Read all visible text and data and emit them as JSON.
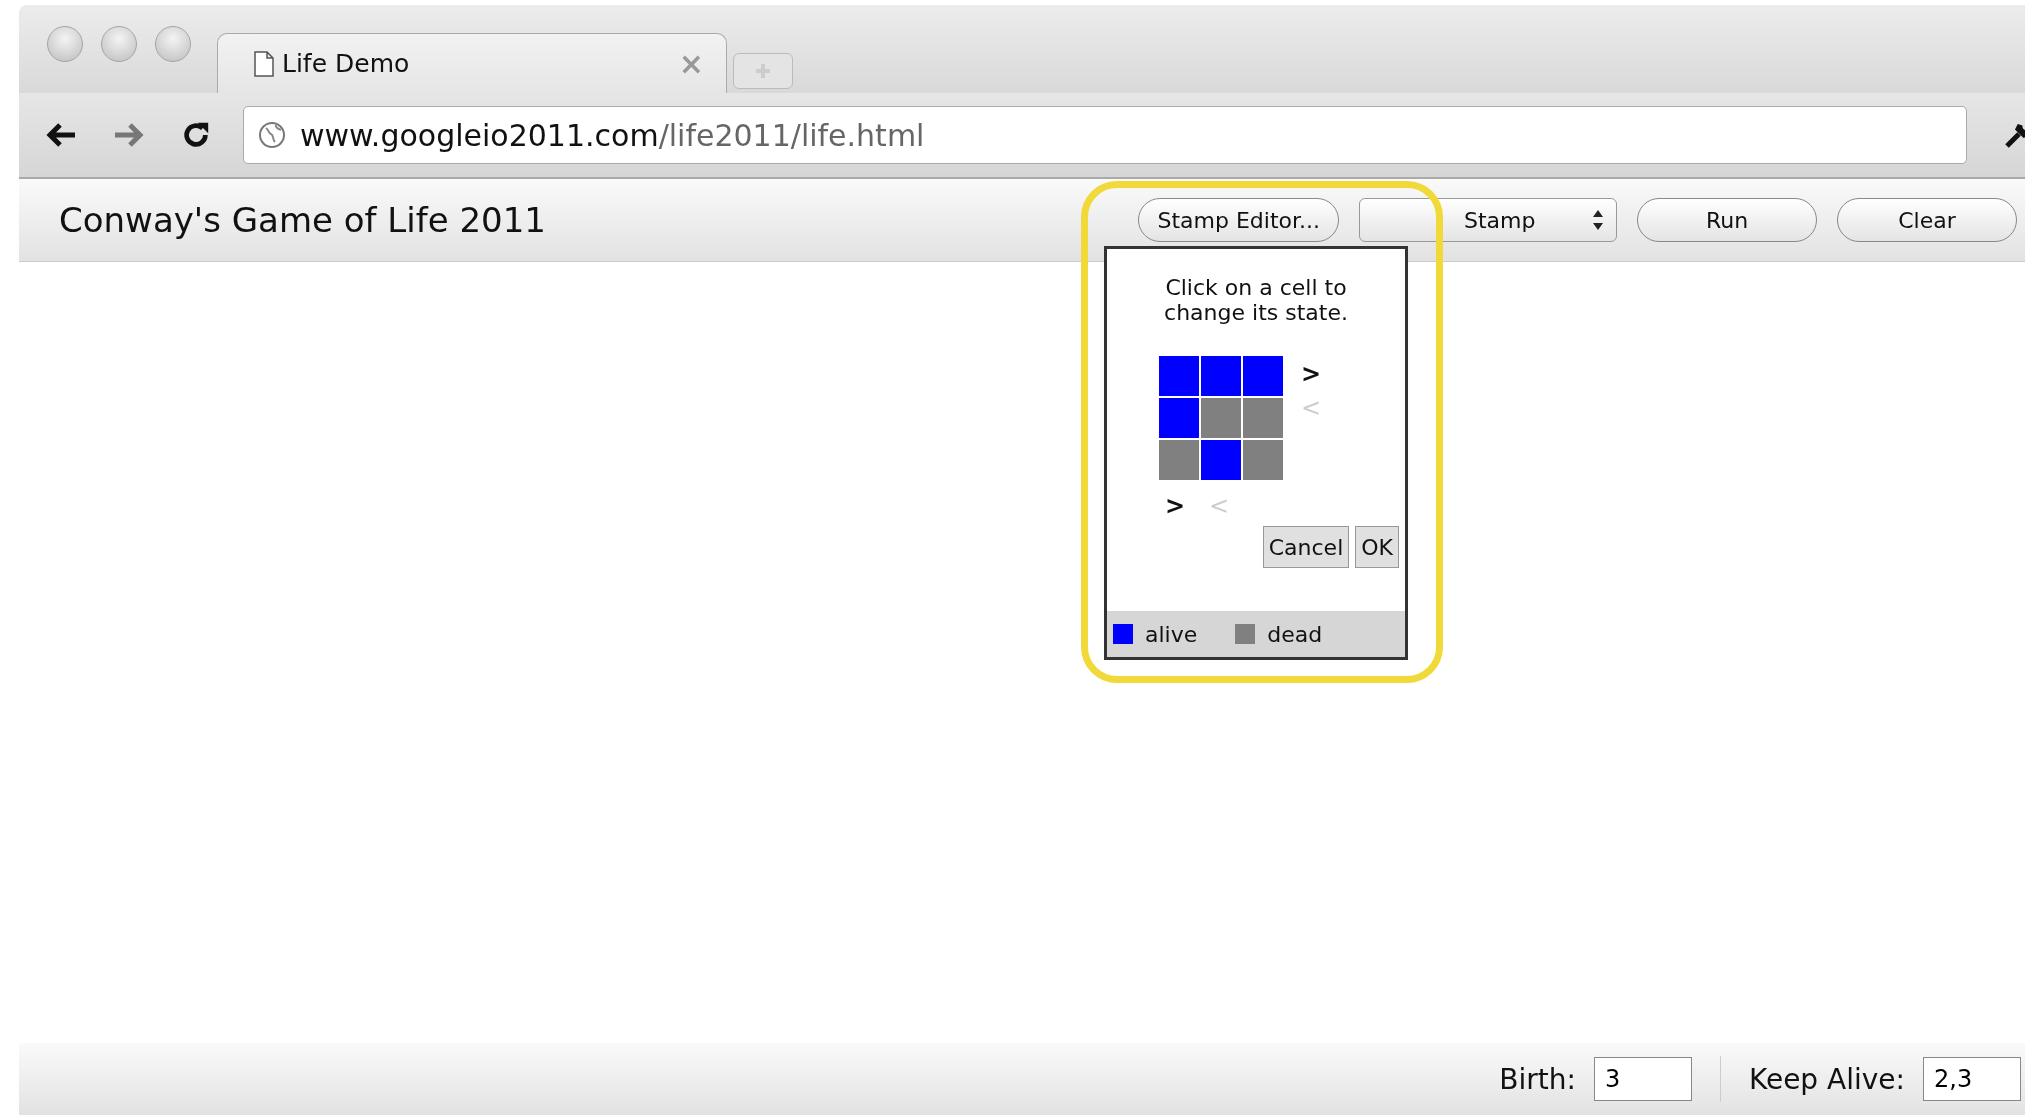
{
  "browser": {
    "tab": {
      "title": "Life Demo",
      "close": "×"
    },
    "url": {
      "host": "www.googleio2011.com",
      "path": "/life2011/life.html"
    }
  },
  "page": {
    "title": "Conway's Game of Life 2011",
    "toolbar": {
      "stamp_editor": "Stamp Editor...",
      "stamp_select": "Stamp",
      "run": "Run",
      "clear": "Clear"
    }
  },
  "stamp_editor": {
    "instructions": "Click on a cell to change its state.",
    "grid": [
      [
        {
          "alive": true
        },
        {
          "alive": true
        },
        {
          "alive": true
        }
      ],
      [
        {
          "alive": true
        },
        {
          "alive": false
        },
        {
          "alive": false
        }
      ],
      [
        {
          "alive": false
        },
        {
          "alive": true
        },
        {
          "alive": false
        }
      ]
    ],
    "row_controls": [
      {
        "label": ">",
        "disabled": false
      },
      {
        "label": "<",
        "disabled": true
      }
    ],
    "column_controls": [
      {
        "label": ">",
        "disabled": false
      },
      {
        "label": "<",
        "disabled": true
      }
    ],
    "buttons": [
      "Cancel",
      "OK"
    ],
    "legend": [
      {
        "label": "alive",
        "color": "#0000ff"
      },
      {
        "label": "dead",
        "color": "#808080"
      }
    ]
  },
  "rules": {
    "birth": {
      "label": "Birth:",
      "value": "3"
    },
    "keep_alive": {
      "label": "Keep Alive:",
      "value": "2,3"
    }
  }
}
